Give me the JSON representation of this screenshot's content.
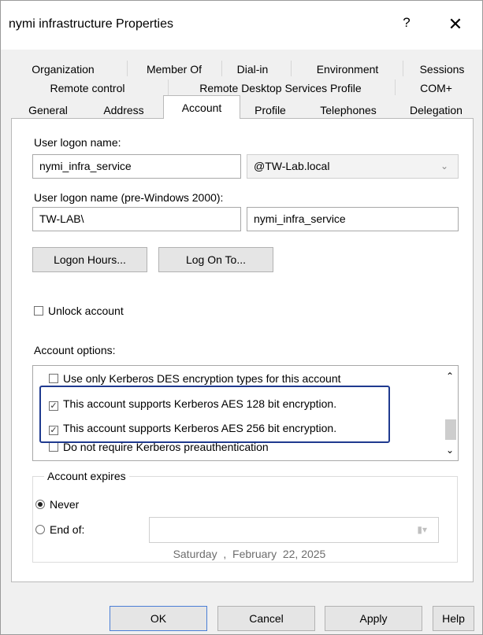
{
  "window": {
    "title": "nymi infrastructure Properties",
    "help_glyph": "?",
    "close_glyph": "✕"
  },
  "tabs": {
    "row1": [
      "Organization",
      "Member Of",
      "Dial-in",
      "Environment",
      "Sessions"
    ],
    "row2": [
      "Remote control",
      "Remote Desktop Services Profile",
      "COM+"
    ],
    "row3": [
      "General",
      "Address",
      "Account",
      "Profile",
      "Telephones",
      "Delegation"
    ],
    "active": "Account"
  },
  "account": {
    "logon_name_label": "User logon name:",
    "logon_name_value": "nymi_infra_service",
    "domain_value": "@TW-Lab.local",
    "pre2000_label": "User logon name (pre-Windows 2000):",
    "pre2000_domain": "TW-LAB\\",
    "pre2000_user": "nymi_infra_service",
    "logon_hours_button": "Logon Hours...",
    "log_on_to_button": "Log On To...",
    "unlock_label": "Unlock account",
    "unlock_checked": false,
    "options_label": "Account options:",
    "options": [
      {
        "label": "Use only Kerberos DES encryption types for this account",
        "checked": false
      },
      {
        "label": "This account supports Kerberos AES 128 bit encryption.",
        "checked": true
      },
      {
        "label": "This account supports Kerberos AES 256 bit encryption.",
        "checked": true
      },
      {
        "label": "Do not require Kerberos preauthentication",
        "checked": false
      }
    ],
    "expires_title": "Account expires",
    "never_label": "Never",
    "end_of_label": "End of:",
    "expires_selected": "Never",
    "date_value": "Saturday  ,  February  22, 2025"
  },
  "buttons": {
    "ok": "OK",
    "cancel": "Cancel",
    "apply": "Apply",
    "help": "Help"
  },
  "colors": {
    "highlight_border": "#1f3a8f",
    "default_button_border": "#4a7ed6"
  }
}
